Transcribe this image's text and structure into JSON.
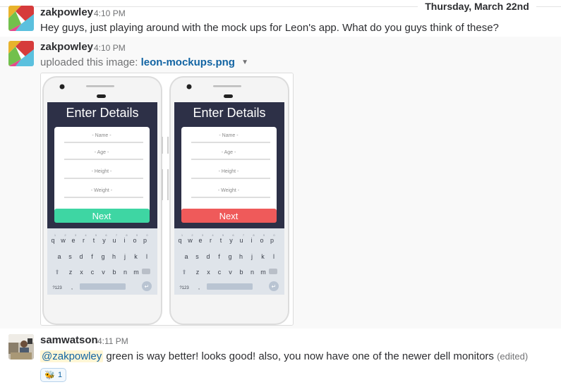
{
  "date_divider": "Thursday, March 22nd",
  "messages": [
    {
      "sender": "zakpowley",
      "time": "4:10 PM",
      "text": "Hey guys, just playing around with the mock ups for Leon's app. What do you guys think of these?"
    },
    {
      "sender": "zakpowley",
      "time": "4:10 PM",
      "upload_prefix": "uploaded this image:",
      "file_name": "leon-mockups.png",
      "caret_icon": "chevron-down-icon"
    },
    {
      "sender": "samwatson",
      "time": "4:11 PM",
      "mention": "@zakpowley",
      "text": " green is way better! looks good! also, you now have one of the newer dell monitors",
      "edited": "(edited)",
      "reaction": {
        "emoji": "🐝",
        "count": "1"
      }
    }
  ],
  "mockups": {
    "screen_title": "Enter Details",
    "fields": [
      "- Name -",
      "- Age -",
      "- Height -",
      "- Weight -"
    ],
    "button_label": "Next",
    "phones": [
      {
        "button_color": "#3ed6a3"
      },
      {
        "button_color": "#ef5a5a"
      }
    ],
    "keyboard": {
      "row1": [
        "q",
        "w",
        "e",
        "r",
        "t",
        "y",
        "u",
        "i",
        "o",
        "p"
      ],
      "row1_hints": [
        "1",
        "2",
        "3",
        "4",
        "5",
        "6",
        "7",
        "8",
        "9",
        "0"
      ],
      "row2": [
        "a",
        "s",
        "d",
        "f",
        "g",
        "h",
        "j",
        "k",
        "l"
      ],
      "row3": [
        "z",
        "x",
        "c",
        "v",
        "b",
        "n",
        "m"
      ],
      "symbols_key": "?123",
      "comma_key": ","
    },
    "colors": {
      "header_bg": "#2d3047",
      "keyboard_bg": "#dfe4ea",
      "phone_body": "#f4f4f4"
    }
  },
  "colors": {
    "link": "#1264a3",
    "mention_bg": "#fff6d6",
    "text": "#2c2d30",
    "muted": "#717274"
  }
}
